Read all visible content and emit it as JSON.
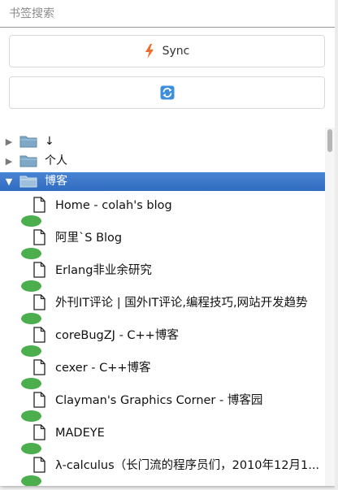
{
  "search": {
    "placeholder": "书签搜索",
    "value": ""
  },
  "sync_button": {
    "label": "Sync",
    "icon": "lightning-icon"
  },
  "refresh_button": {
    "icon": "refresh-icon"
  },
  "colors": {
    "selected_bg": "#3576c9",
    "dot": "#4cae4c",
    "folder": "#7fa7c7",
    "sync_icon": "#f06b2a",
    "refresh_icon": "#3e8edc"
  },
  "folders": [
    {
      "label": "↓",
      "expanded": false,
      "selected": false
    },
    {
      "label": "个人",
      "expanded": false,
      "selected": false
    },
    {
      "label": "博客",
      "expanded": true,
      "selected": true
    }
  ],
  "bookmarks": [
    {
      "label": "Home - colah's blog"
    },
    {
      "label": "阿里`S Blog"
    },
    {
      "label": "Erlang非业余研究"
    },
    {
      "label": "外刊IT评论 | 国外IT评论,编程技巧,网站开发趋势"
    },
    {
      "label": "coreBugZJ - C++博客"
    },
    {
      "label": "cexer - C++博客"
    },
    {
      "label": "Clayman's Graphics Corner - 博客园"
    },
    {
      "label": "MADEYE"
    },
    {
      "label": "λ-calculus（长门流的程序员们，2010年12月1..."
    }
  ]
}
